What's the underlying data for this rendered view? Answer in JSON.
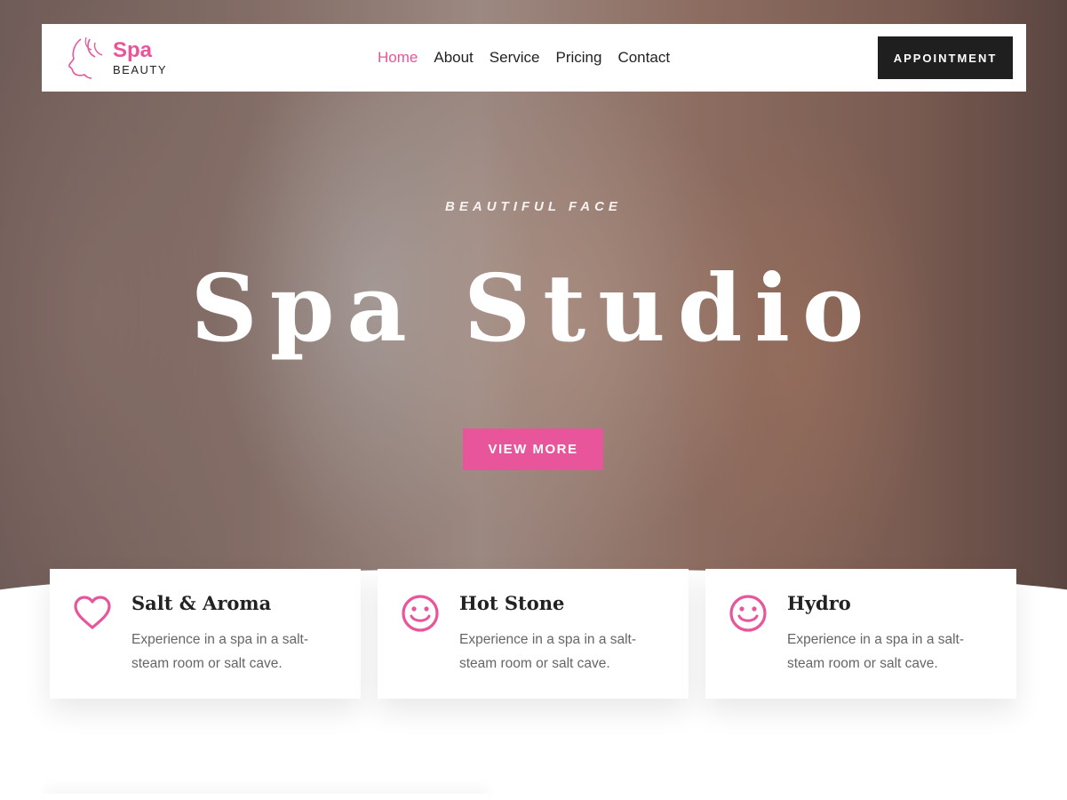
{
  "brand": {
    "name": "Spa",
    "tagline": "BEAUTY",
    "accent_color": "#e8559a"
  },
  "nav": {
    "items": [
      {
        "label": "Home",
        "active": true
      },
      {
        "label": "About",
        "active": false
      },
      {
        "label": "Service",
        "active": false
      },
      {
        "label": "Pricing",
        "active": false
      },
      {
        "label": "Contact",
        "active": false
      }
    ],
    "cta_label": "APPOINTMENT"
  },
  "hero": {
    "eyebrow": "BEAUTIFUL FACE",
    "title": "Spa Studio",
    "button_label": "VIEW MORE"
  },
  "features": [
    {
      "icon": "heart-icon",
      "title": "Salt & Aroma",
      "description": "Experience in a spa in a salt-steam room or salt cave."
    },
    {
      "icon": "smile-icon",
      "title": "Hot Stone",
      "description": "Experience in a spa in a salt-steam room or salt cave."
    },
    {
      "icon": "smile-icon",
      "title": "Hydro",
      "description": "Experience in a spa in a salt-steam room or salt cave."
    }
  ]
}
